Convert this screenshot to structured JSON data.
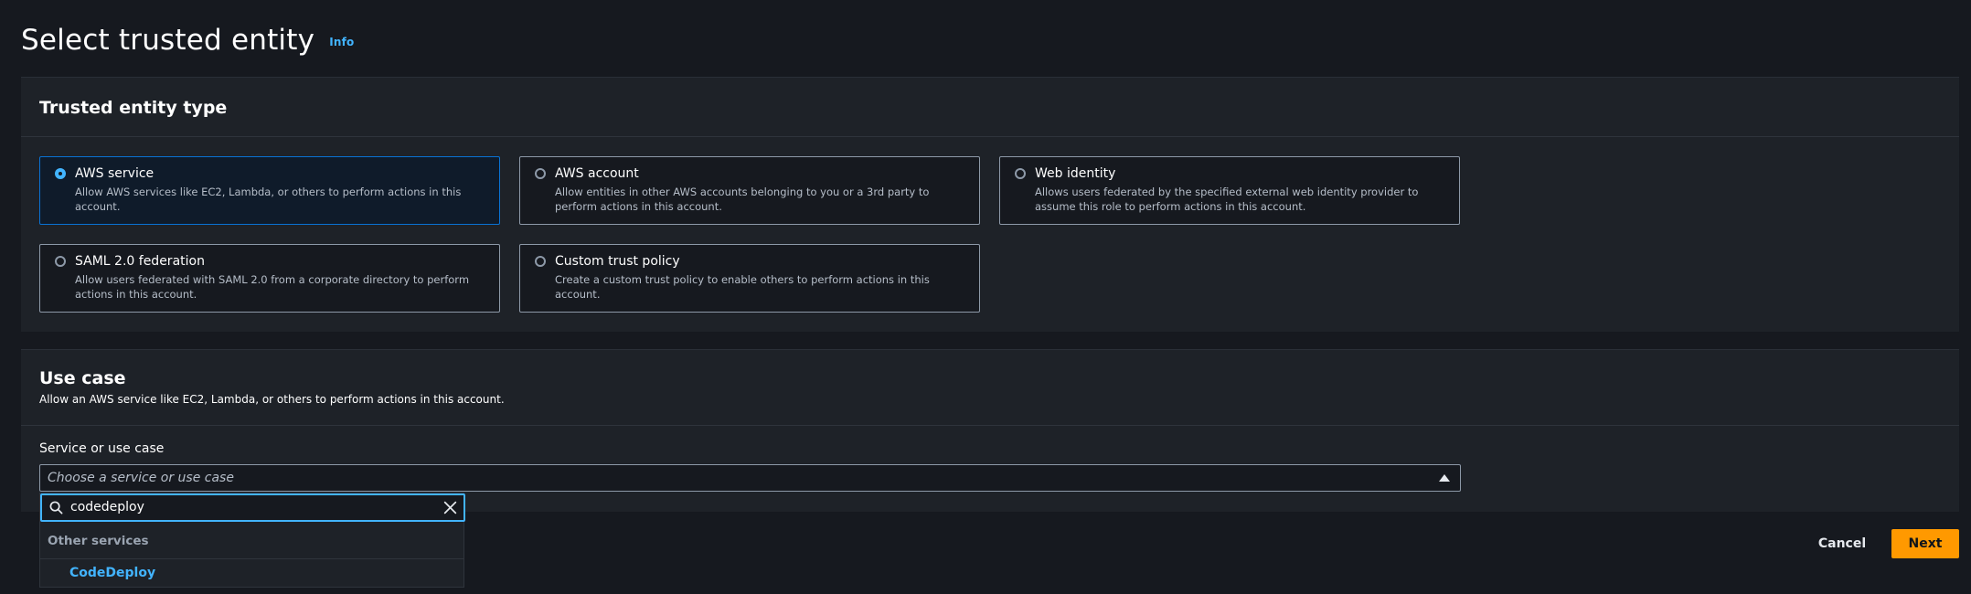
{
  "page": {
    "title": "Select trusted entity",
    "info_link": "Info"
  },
  "trusted_entity": {
    "heading": "Trusted entity type",
    "options": [
      {
        "title": "AWS service",
        "description": "Allow AWS services like EC2, Lambda, or others to perform actions in this account.",
        "selected": true
      },
      {
        "title": "AWS account",
        "description": "Allow entities in other AWS accounts belonging to you or a 3rd party to perform actions in this account.",
        "selected": false
      },
      {
        "title": "Web identity",
        "description": "Allows users federated by the specified external web identity provider to assume this role to perform actions in this account.",
        "selected": false
      },
      {
        "title": "SAML 2.0 federation",
        "description": "Allow users federated with SAML 2.0 from a corporate directory to perform actions in this account.",
        "selected": false
      },
      {
        "title": "Custom trust policy",
        "description": "Create a custom trust policy to enable others to perform actions in this account.",
        "selected": false
      }
    ]
  },
  "use_case": {
    "heading": "Use case",
    "description": "Allow an AWS service like EC2, Lambda, or others to perform actions in this account.",
    "field_label": "Service or use case",
    "select_placeholder": "Choose a service or use case",
    "search_value": "codedeploy",
    "group_label": "Other services",
    "results": [
      "CodeDeploy"
    ]
  },
  "actions": {
    "cancel": "Cancel",
    "next": "Next"
  },
  "colors": {
    "accent": "#42b4ff",
    "primary_button": "#ff9900",
    "selected_border": "#0972d3"
  }
}
